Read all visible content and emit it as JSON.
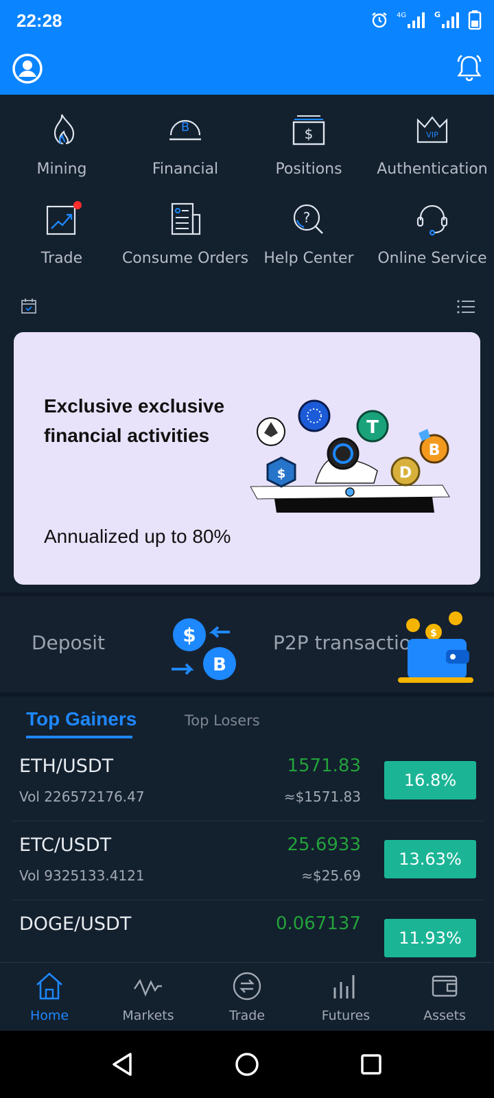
{
  "status_bar": {
    "time": "22:28",
    "network1": "4G",
    "network2": "G"
  },
  "grid": [
    {
      "label": "Mining",
      "icon": "fire-icon"
    },
    {
      "label": "Financial",
      "icon": "financial-coin-icon"
    },
    {
      "label": "Positions",
      "icon": "positions-dollar-icon"
    },
    {
      "label": "Authentication",
      "icon": "vip-crown-icon"
    },
    {
      "label": "Trade",
      "icon": "trade-chart-icon"
    },
    {
      "label": "Consume Orders",
      "icon": "orders-document-icon"
    },
    {
      "label": "Help Center",
      "icon": "help-search-icon"
    },
    {
      "label": "Online Service",
      "icon": "headset-icon"
    }
  ],
  "banner": {
    "title": "Exclusive exclusive financial activities",
    "subtitle": "Annualized up to 80%",
    "background": "#e8e2fa"
  },
  "strip": {
    "deposit": "Deposit",
    "p2p": "P2P transactions"
  },
  "tabs": {
    "active": "Top Gainers",
    "inactive": "Top Losers"
  },
  "gainers": [
    {
      "pair": "ETH/USDT",
      "vol": "Vol 226572176.47",
      "price": "1571.83",
      "usd": "≈$1571.83",
      "change": "16.8%"
    },
    {
      "pair": "ETC/USDT",
      "vol": "Vol 9325133.4121",
      "price": "25.6933",
      "usd": "≈$25.69",
      "change": "13.63%"
    },
    {
      "pair": "DOGE/USDT",
      "vol": "",
      "price": "0.067137",
      "usd": "",
      "change": "11.93%"
    }
  ],
  "bottom_nav": [
    {
      "label": "Home",
      "icon": "home-icon",
      "active": true
    },
    {
      "label": "Markets",
      "icon": "markets-wave-icon",
      "active": false
    },
    {
      "label": "Trade",
      "icon": "trade-circle-icon",
      "active": false
    },
    {
      "label": "Futures",
      "icon": "futures-bars-icon",
      "active": false
    },
    {
      "label": "Assets",
      "icon": "wallet-icon",
      "active": false
    }
  ],
  "colors": {
    "accent": "#0a84ff",
    "background": "#13202e",
    "positive": "#23a23a",
    "badge": "#1bb596"
  }
}
